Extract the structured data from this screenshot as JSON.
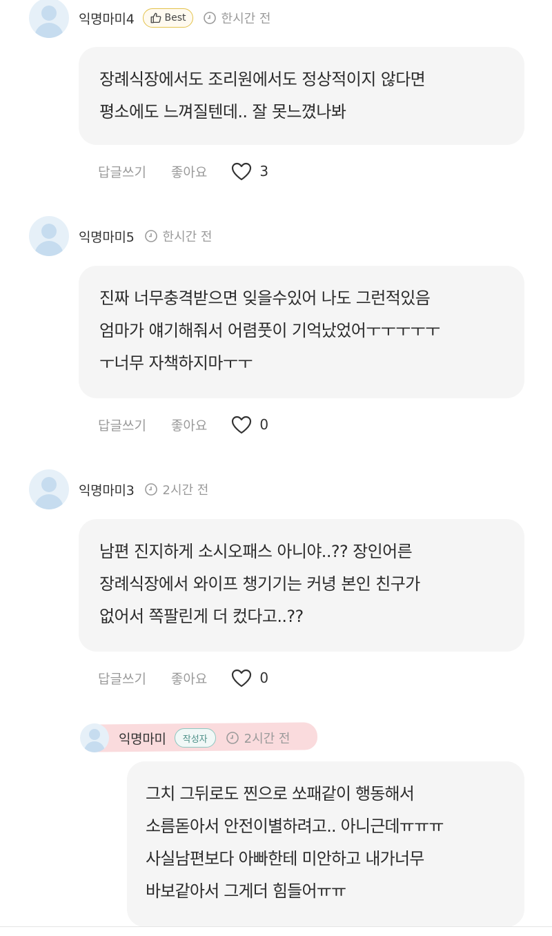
{
  "comments": [
    {
      "author": "익명마미4",
      "badge": "Best",
      "time": "한시간 전",
      "lines": [
        "장례식장에서도 조리원에서도 정상적이지 않다면",
        "평소에도 느껴질텐데.. 잘 못느꼈나봐"
      ],
      "reply_label": "답글쓰기",
      "like_label": "좋아요",
      "likes": "3"
    },
    {
      "author": "익명마미5",
      "time": "한시간 전",
      "lines": [
        "진짜 너무충격받으면 잊을수있어 나도 그런적있음",
        "엄마가 얘기해줘서 어렴풋이 기억났었어ㅜㅜㅜㅜㅜ",
        "ㅜ너무 자책하지마ㅜㅜ"
      ],
      "reply_label": "답글쓰기",
      "like_label": "좋아요",
      "likes": "0"
    },
    {
      "author": "익명마미3",
      "time": "2시간 전",
      "lines": [
        "남편 진지하게 소시오패스 아니야..?? 장인어른",
        "장례식장에서 와이프 챙기기는 커녕 본인 친구가",
        "없어서 쪽팔린게 더 컸다고..??"
      ],
      "reply_label": "답글쓰기",
      "like_label": "좋아요",
      "likes": "0"
    }
  ],
  "reply": {
    "author": "익명마미",
    "badge": "작성자",
    "time": "2시간 전",
    "lines": [
      "그치 그뒤로도 찐으로 쏘패같이 행동해서",
      "소름돋아서 안전이별하려고.. 아니근데ㅠㅠㅠ",
      "사실남편보다 아빠한테 미안하고 내가너무",
      "바보같아서 그게더 힘들어ㅠㅠ"
    ]
  },
  "colors": {
    "bubble": "#f5f5f5",
    "avatar": "#e6f0f8",
    "best_badge_border": "#e3c24a",
    "writer_badge": "#4d8f87",
    "highlight": "#f4aaaf",
    "meta_text": "#9a9a9a"
  },
  "icons": [
    "user-avatar-icon",
    "thumbs-up-icon",
    "clock-icon",
    "heart-icon"
  ]
}
